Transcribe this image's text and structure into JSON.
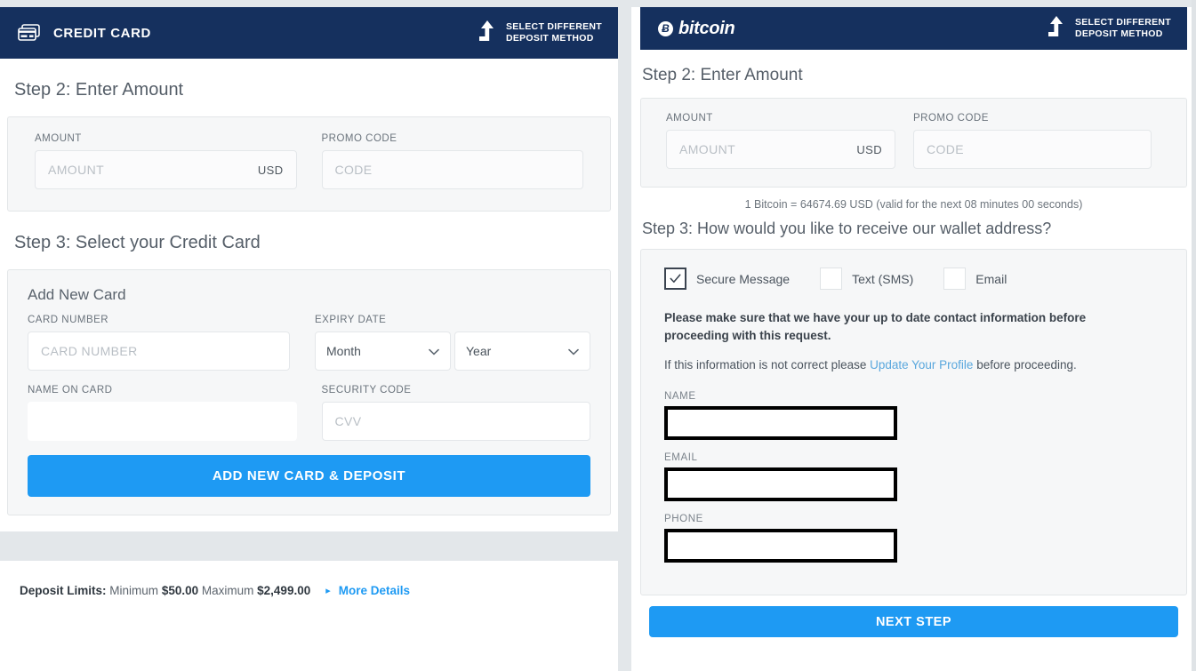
{
  "left_panel": {
    "header": {
      "title": "CREDIT CARD",
      "icon": "credit-cards-icon",
      "switch_method_line1": "SELECT DIFFERENT",
      "switch_method_line2": "DEPOSIT METHOD",
      "switch_icon": "turn-up-arrow-icon",
      "bg_color": "#15305e"
    },
    "step2": {
      "title": "Step 2: Enter Amount",
      "amount_label": "AMOUNT",
      "amount_placeholder": "AMOUNT",
      "amount_value": "",
      "currency_suffix": "USD",
      "promo_label": "PROMO CODE",
      "promo_placeholder": "CODE",
      "promo_value": ""
    },
    "step3": {
      "title": "Step 3: Select your Credit Card",
      "add_new_card": "Add New Card",
      "card_number_label": "CARD NUMBER",
      "card_number_placeholder": "CARD NUMBER",
      "card_number_value": "",
      "expiry_label": "EXPIRY DATE",
      "month_selected": "Month",
      "year_selected": "Year",
      "name_on_card_label": "NAME ON CARD",
      "name_on_card_value": "",
      "security_code_label": "SECURITY CODE",
      "security_code_placeholder": "CVV",
      "security_code_value": "",
      "submit_label": "ADD NEW CARD & DEPOSIT"
    },
    "footer": {
      "limits_prefix": "Deposit Limits:",
      "minimum_word": "Minimum",
      "minimum_value": "$50.00",
      "maximum_word": "Maximum",
      "maximum_value": "$2,499.00",
      "arrow": "▸",
      "more_details": "More Details"
    }
  },
  "right_panel": {
    "header": {
      "brand_mark": "Ƀ",
      "brand_text": "bitcoin",
      "switch_method_line1": "SELECT DIFFERENT",
      "switch_method_line2": "DEPOSIT METHOD",
      "switch_icon": "turn-up-arrow-icon"
    },
    "step2": {
      "title": "Step 2: Enter Amount",
      "amount_label": "AMOUNT",
      "amount_placeholder": "AMOUNT",
      "amount_value": "",
      "currency_suffix": "USD",
      "promo_label": "PROMO CODE",
      "promo_placeholder": "CODE",
      "promo_value": ""
    },
    "rate_line": "1 Bitcoin = 64674.69 USD (valid for the next 08 minutes 00 seconds)",
    "step3": {
      "title": "Step 3: How would you like to receive our wallet address?",
      "options": [
        {
          "label": "Secure Message",
          "checked": true
        },
        {
          "label": "Text (SMS)",
          "checked": false
        },
        {
          "label": "Email",
          "checked": false
        }
      ],
      "notice_bold": "Please make sure that we have your up to date contact information before proceeding with this request.",
      "notice_prefix": "If this information is not correct please ",
      "notice_link": "Update Your Profile",
      "notice_suffix": " before proceeding.",
      "name_label": "NAME",
      "name_value": "",
      "email_label": "EMAIL",
      "email_value": "",
      "phone_label": "PHONE",
      "phone_value": ""
    },
    "next_step_label": "NEXT STEP"
  },
  "colors": {
    "navy": "#15305e",
    "primary_blue": "#1e9af3",
    "link_blue": "#59a7dd",
    "page_gray": "#e3e7ea"
  }
}
